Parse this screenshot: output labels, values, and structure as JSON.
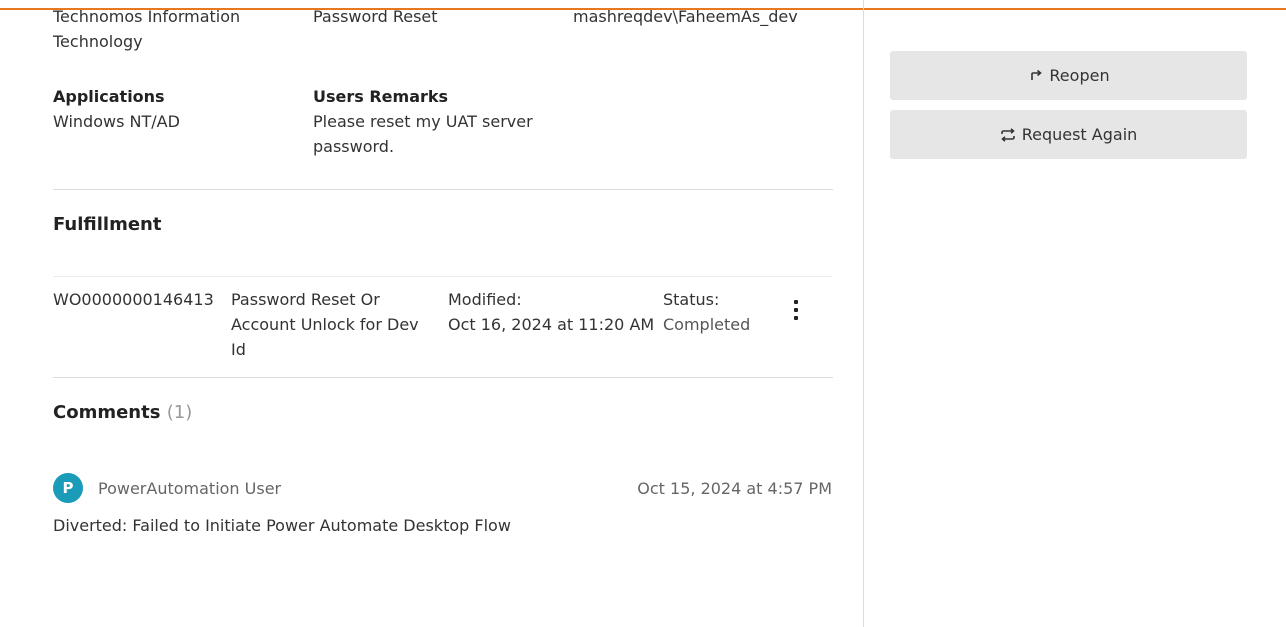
{
  "details": {
    "row1": {
      "company_value": "Technomos Information Technology",
      "service_value": "Password Reset",
      "userid_value": "mashreqdev\\FaheemAs_dev"
    },
    "applications": {
      "label": "Applications",
      "value": "Windows NT/AD"
    },
    "remarks": {
      "label": "Users Remarks",
      "value": "Please reset my UAT server password."
    }
  },
  "fulfillment": {
    "title": "Fulfillment",
    "item": {
      "id": "WO0000000146413",
      "name": "Password Reset Or Account Unlock for Dev Id",
      "modified_label": "Modified:",
      "modified_value": "Oct 16, 2024 at 11:20 AM",
      "status_label": "Status:",
      "status_value": "Completed"
    }
  },
  "comments": {
    "title": "Comments",
    "count": "(1)",
    "items": [
      {
        "avatar_initial": "P",
        "author": "PowerAutomation User",
        "timestamp": "Oct 15, 2024 at 4:57 PM",
        "text": "Diverted: Failed to Initiate Power Automate Desktop Flow"
      }
    ]
  },
  "actions": {
    "reopen_label": "Reopen",
    "reopen_icon": "reopen-arrow-icon",
    "request_again_label": "Request Again",
    "request_again_icon": "repeat-icon"
  },
  "colors": {
    "accent_rule": "#e87722",
    "avatar_bg": "#1a9bb8",
    "button_bg": "#e6e6e6"
  }
}
